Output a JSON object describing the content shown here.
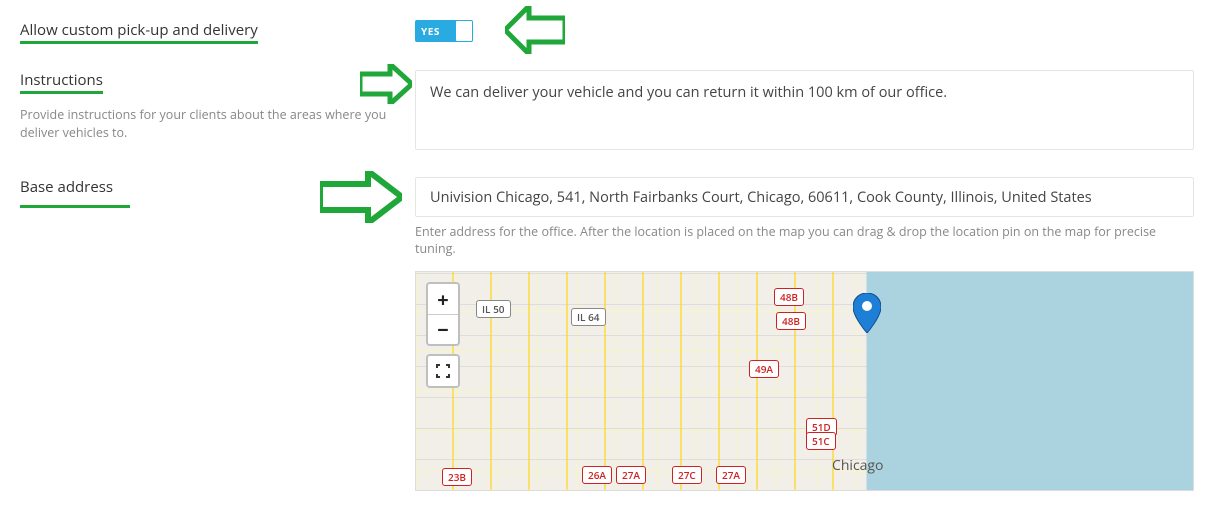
{
  "row1": {
    "label": "Allow custom pick-up and delivery",
    "toggle_text": "YES",
    "toggle_value": true
  },
  "row2": {
    "label": "Instructions",
    "helper": "Provide instructions for your clients about the areas where you deliver vehicles to.",
    "value": "We can deliver your vehicle and you can return it within 100 km of our office."
  },
  "row3": {
    "label": "Base address",
    "value": "Univision Chicago, 541, North Fairbanks Court, Chicago, 60611, Cook County, Illinois, United States",
    "helper": "Enter address for the office. After the location is placed on the map you can drag & drop the location pin on the map for precise tuning."
  },
  "map": {
    "zoom_in": "+",
    "zoom_out": "−",
    "city": "Chicago",
    "shields": [
      "IL 50",
      "IL 64",
      "48B",
      "48B",
      "49A",
      "51D",
      "51C",
      "23B",
      "26A",
      "27A",
      "27C",
      "27A"
    ]
  }
}
